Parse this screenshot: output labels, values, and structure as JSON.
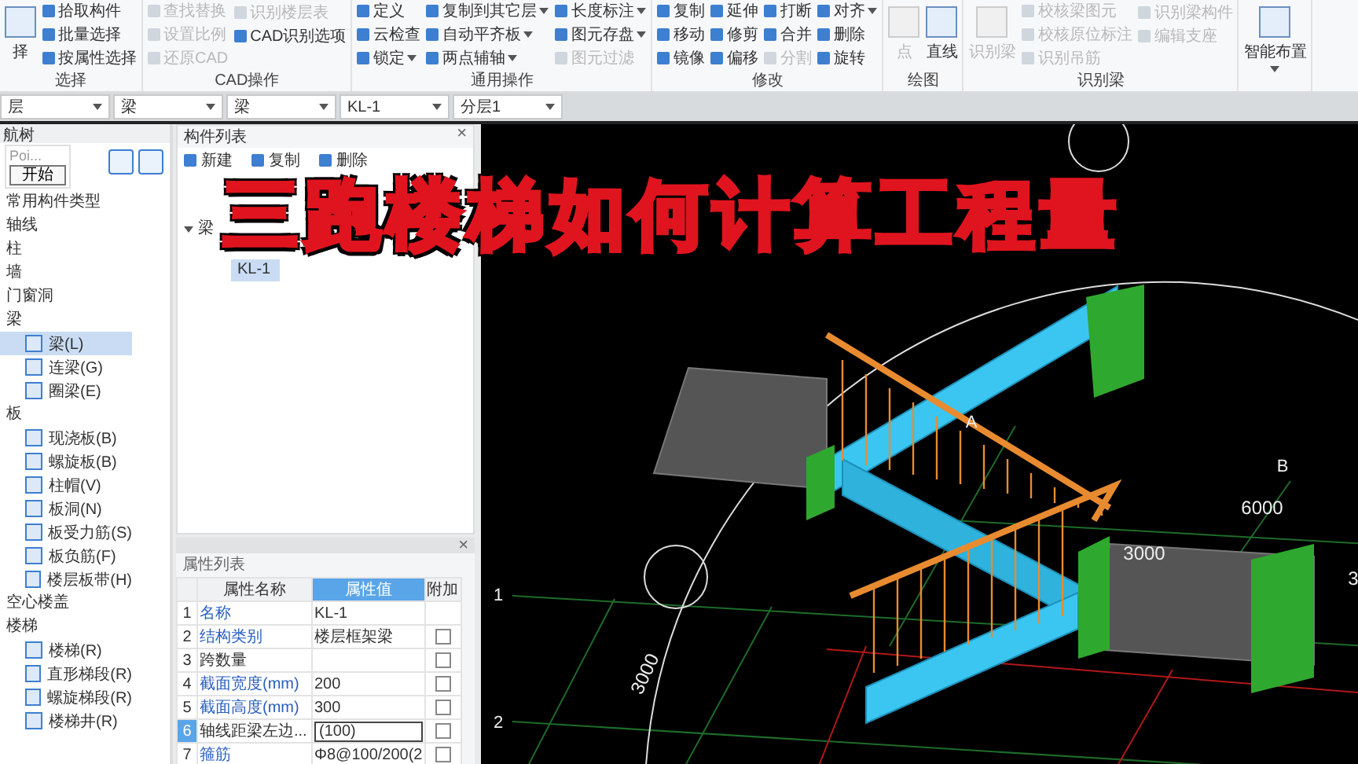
{
  "ribbon": {
    "groups": [
      {
        "label": "选择",
        "columns": [
          [
            {
              "label": "择",
              "kind": "big",
              "disabled": false,
              "dropdown": false
            }
          ],
          [
            {
              "label": "拾取构件",
              "kind": "small",
              "disabled": false,
              "dropdown": false
            },
            {
              "label": "批量选择",
              "kind": "small",
              "disabled": false,
              "dropdown": false
            },
            {
              "label": "按属性选择",
              "kind": "small",
              "disabled": false,
              "dropdown": false
            }
          ]
        ]
      },
      {
        "label": "CAD操作",
        "columns": [
          [
            {
              "label": "查找替换",
              "kind": "small",
              "disabled": true,
              "dropdown": false
            },
            {
              "label": "设置比例",
              "kind": "small",
              "disabled": true,
              "dropdown": false
            },
            {
              "label": "还原CAD",
              "kind": "small",
              "disabled": true,
              "dropdown": false
            }
          ],
          [
            {
              "label": "识别楼层表",
              "kind": "small",
              "disabled": true,
              "dropdown": false
            },
            {
              "label": "CAD识别选项",
              "kind": "small",
              "disabled": false,
              "dropdown": false
            }
          ]
        ]
      },
      {
        "label": "通用操作",
        "columns": [
          [
            {
              "label": "定义",
              "kind": "small",
              "disabled": false,
              "dropdown": false
            },
            {
              "label": "云检查",
              "kind": "small",
              "disabled": false,
              "dropdown": false
            },
            {
              "label": "锁定",
              "kind": "small",
              "disabled": false,
              "dropdown": true
            }
          ],
          [
            {
              "label": "复制到其它层",
              "kind": "small",
              "disabled": false,
              "dropdown": true
            },
            {
              "label": "自动平齐板",
              "kind": "small",
              "disabled": false,
              "dropdown": true
            },
            {
              "label": "两点辅轴",
              "kind": "small",
              "disabled": false,
              "dropdown": true
            }
          ],
          [
            {
              "label": "长度标注",
              "kind": "small",
              "disabled": false,
              "dropdown": true
            },
            {
              "label": "图元存盘",
              "kind": "small",
              "disabled": false,
              "dropdown": true
            },
            {
              "label": "图元过滤",
              "kind": "small",
              "disabled": true,
              "dropdown": false
            }
          ]
        ]
      },
      {
        "label": "修改",
        "columns": [
          [
            {
              "label": "复制",
              "kind": "small",
              "disabled": false,
              "dropdown": false
            },
            {
              "label": "移动",
              "kind": "small",
              "disabled": false,
              "dropdown": false
            },
            {
              "label": "镜像",
              "kind": "small",
              "disabled": false,
              "dropdown": false
            }
          ],
          [
            {
              "label": "延伸",
              "kind": "small",
              "disabled": false,
              "dropdown": false
            },
            {
              "label": "修剪",
              "kind": "small",
              "disabled": false,
              "dropdown": false
            },
            {
              "label": "偏移",
              "kind": "small",
              "disabled": false,
              "dropdown": false
            }
          ],
          [
            {
              "label": "打断",
              "kind": "small",
              "disabled": false,
              "dropdown": false
            },
            {
              "label": "合并",
              "kind": "small",
              "disabled": false,
              "dropdown": false
            },
            {
              "label": "分割",
              "kind": "small",
              "disabled": true,
              "dropdown": false
            }
          ],
          [
            {
              "label": "对齐",
              "kind": "small",
              "disabled": false,
              "dropdown": true
            },
            {
              "label": "删除",
              "kind": "small",
              "disabled": false,
              "dropdown": false
            },
            {
              "label": "旋转",
              "kind": "small",
              "disabled": false,
              "dropdown": false
            }
          ]
        ]
      },
      {
        "label": "绘图",
        "columns": [
          [
            {
              "label": "点",
              "kind": "big",
              "disabled": true,
              "dropdown": false
            }
          ],
          [
            {
              "label": "直线",
              "kind": "big",
              "disabled": false,
              "dropdown": false
            }
          ]
        ]
      },
      {
        "label": "识别梁",
        "columns": [
          [
            {
              "label": "识别梁",
              "kind": "big",
              "disabled": true,
              "dropdown": false
            }
          ],
          [
            {
              "label": "校核梁图元",
              "kind": "small",
              "disabled": true,
              "dropdown": false
            },
            {
              "label": "校核原位标注",
              "kind": "small",
              "disabled": true,
              "dropdown": false
            },
            {
              "label": "识别吊筋",
              "kind": "small",
              "disabled": true,
              "dropdown": false
            }
          ],
          [
            {
              "label": "识别梁构件",
              "kind": "small",
              "disabled": true,
              "dropdown": false
            },
            {
              "label": "编辑支座",
              "kind": "small",
              "disabled": true,
              "dropdown": false
            }
          ]
        ]
      },
      {
        "columns": [
          [
            {
              "label": "智能布置",
              "kind": "big",
              "disabled": false,
              "dropdown": true
            }
          ]
        ]
      }
    ]
  },
  "toolbar": {
    "dropdowns": [
      "层",
      "梁",
      "梁",
      "KL-1",
      "分层1"
    ]
  },
  "nav_tree": {
    "title": "航树",
    "popup": {
      "text": "Poi...",
      "button": "开始"
    },
    "items": [
      {
        "label": "常用构件类型",
        "selected": false
      },
      {
        "label": "轴线",
        "selected": false
      },
      {
        "label": "柱",
        "selected": false
      },
      {
        "label": "墙",
        "selected": false
      },
      {
        "label": "门窗洞",
        "selected": false
      },
      {
        "label": "梁",
        "selected": false,
        "children": [
          {
            "label": "梁(L)",
            "selected": true
          },
          {
            "label": "连梁(G)",
            "selected": false
          },
          {
            "label": "圈梁(E)",
            "selected": false
          }
        ]
      },
      {
        "label": "板",
        "selected": false,
        "children": [
          {
            "label": "现浇板(B)",
            "selected": false
          },
          {
            "label": "螺旋板(B)",
            "selected": false
          },
          {
            "label": "柱帽(V)",
            "selected": false
          },
          {
            "label": "板洞(N)",
            "selected": false
          },
          {
            "label": "板受力筋(S)",
            "selected": false
          },
          {
            "label": "板负筋(F)",
            "selected": false
          },
          {
            "label": "楼层板带(H)",
            "selected": false
          }
        ]
      },
      {
        "label": "空心楼盖",
        "selected": false
      },
      {
        "label": "楼梯",
        "selected": false,
        "children": [
          {
            "label": "楼梯(R)",
            "selected": false
          },
          {
            "label": "直形梯段(R)",
            "selected": false
          },
          {
            "label": "螺旋梯段(R)",
            "selected": false
          },
          {
            "label": "楼梯井(R)",
            "selected": false
          }
        ]
      }
    ]
  },
  "component_list": {
    "title": "构件列表",
    "close": "×",
    "actions": [
      "新建",
      "复制",
      "删除"
    ],
    "tree": [
      {
        "label": "梁",
        "selected": false,
        "children": [
          {
            "label": "KL-1",
            "selected": true
          }
        ]
      }
    ]
  },
  "property_list": {
    "close": "×",
    "title": "属性列表",
    "columns": [
      "属性名称",
      "属性值",
      "附加"
    ],
    "rows": [
      {
        "no": "1",
        "name": "名称",
        "value": "KL-1",
        "public": true,
        "selected": false
      },
      {
        "no": "2",
        "name": "结构类别",
        "value": "楼层框架梁",
        "public": true,
        "selected": false,
        "checked": false
      },
      {
        "no": "3",
        "name": "跨数量",
        "value": "",
        "public": false,
        "selected": false,
        "checked": false
      },
      {
        "no": "4",
        "name": "截面宽度(mm)",
        "value": "200",
        "public": true,
        "selected": false,
        "checked": false
      },
      {
        "no": "5",
        "name": "截面高度(mm)",
        "value": "300",
        "public": true,
        "selected": false,
        "checked": false
      },
      {
        "no": "6",
        "name": "轴线距梁左边...",
        "value": "(100)",
        "public": false,
        "selected": true,
        "checked": false
      },
      {
        "no": "7",
        "name": "箍筋",
        "value": "Φ8@100/200(2",
        "public": true,
        "selected": false,
        "checked": false
      }
    ]
  },
  "view_3d": {
    "labels": [
      {
        "text": "A",
        "kind": "axis"
      },
      {
        "text": "B",
        "kind": "axis"
      },
      {
        "text": "1",
        "kind": "axis"
      },
      {
        "text": "2",
        "kind": "axis"
      },
      {
        "text": "6000",
        "kind": "dimension"
      },
      {
        "text": "3000",
        "kind": "dimension"
      },
      {
        "text": "3000",
        "kind": "dimension-rotated"
      },
      {
        "text": "3",
        "kind": "dimension"
      }
    ]
  },
  "overlay_title": "三跑楼梯如何计算工程量"
}
